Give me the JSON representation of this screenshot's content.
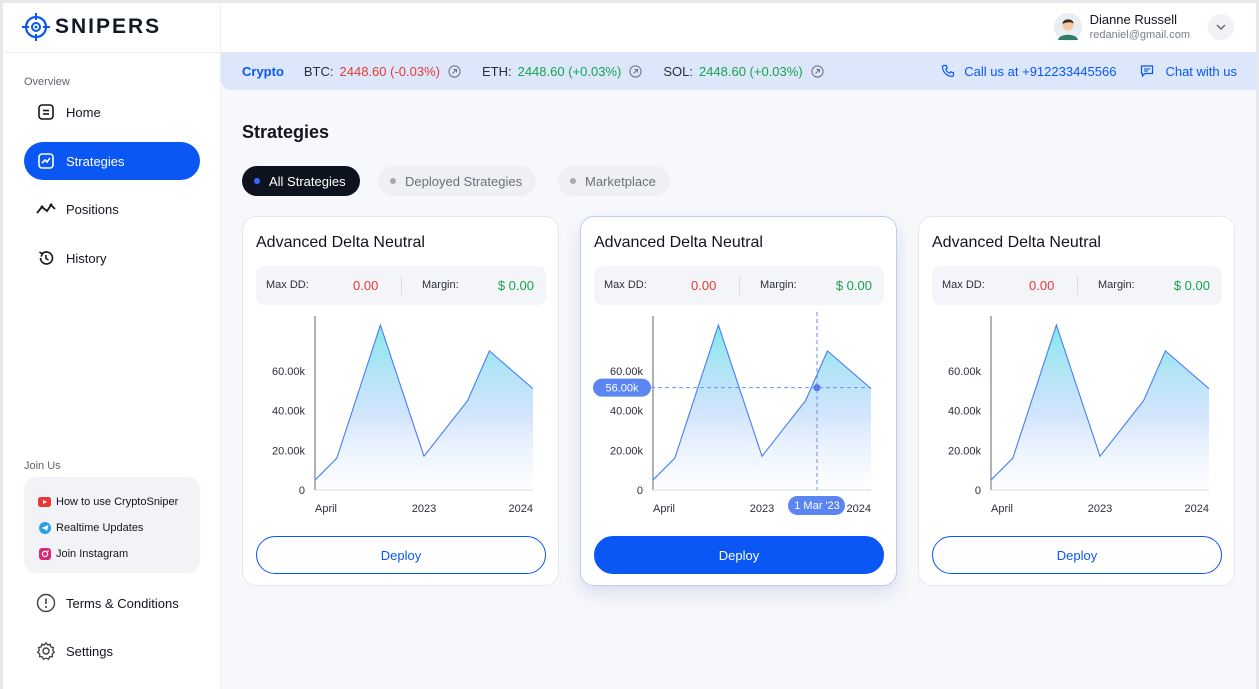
{
  "brand": {
    "name": "SNIPERS",
    "accent": "#0a57f5"
  },
  "sidebar": {
    "overview_label": "Overview",
    "items": [
      {
        "label": "Home",
        "icon": "home-icon"
      },
      {
        "label": "Strategies",
        "icon": "chart-icon",
        "active": true
      },
      {
        "label": "Positions",
        "icon": "trend-icon"
      },
      {
        "label": "History",
        "icon": "history-icon"
      }
    ],
    "join_label": "Join Us",
    "join_links": [
      {
        "label": "How to use CryptoSniper",
        "icon": "youtube-icon"
      },
      {
        "label": "Realtime Updates",
        "icon": "telegram-icon"
      },
      {
        "label": "Join Instagram",
        "icon": "instagram-icon"
      }
    ],
    "bottom_items": [
      {
        "label": "Terms & Conditions",
        "icon": "info-icon"
      },
      {
        "label": "Settings",
        "icon": "gear-icon"
      }
    ]
  },
  "user": {
    "name": "Dianne Russell",
    "email": "redaniel@gmail.com"
  },
  "ticker": {
    "label": "Crypto",
    "coins": [
      {
        "symbol": "BTC:",
        "value": "2448.60 (-0.03%)",
        "trend": "down"
      },
      {
        "symbol": "ETH:",
        "value": "2448.60 (+0.03%)",
        "trend": "up"
      },
      {
        "symbol": "SOL:",
        "value": "2448.60 (+0.03%)",
        "trend": "up"
      }
    ],
    "call_label": "Call us at +912233445566",
    "chat_label": "Chat with us"
  },
  "page": {
    "title": "Strategies"
  },
  "filters": [
    {
      "label": "All Strategies",
      "active": true
    },
    {
      "label": "Deployed Strategies",
      "active": false
    },
    {
      "label": "Marketplace",
      "active": false
    }
  ],
  "cards": [
    {
      "title": "Advanced Delta Neutral",
      "max_dd_label": "Max DD:",
      "max_dd": "0.00",
      "margin_label": "Margin:",
      "margin": "$ 0.00",
      "deploy_label": "Deploy"
    },
    {
      "title": "Advanced Delta Neutral",
      "max_dd_label": "Max DD:",
      "max_dd": "0.00",
      "margin_label": "Margin:",
      "margin": "$ 0.00",
      "deploy_label": "Deploy",
      "tooltip_value": "56.00k",
      "tooltip_date": "1 Mar '23"
    },
    {
      "title": "Advanced Delta Neutral",
      "max_dd_label": "Max DD:",
      "max_dd": "0.00",
      "margin_label": "Margin:",
      "margin": "$ 0.00",
      "deploy_label": "Deploy"
    }
  ],
  "chart_data": {
    "type": "area",
    "y_ticks": [
      "0",
      "20.00k",
      "40.00k",
      "60.00k"
    ],
    "x_ticks": [
      "April",
      "2023",
      "2024"
    ],
    "ylim": [
      0,
      80000
    ],
    "points": [
      {
        "x": 0.0,
        "y": 5000
      },
      {
        "x": 0.1,
        "y": 16000
      },
      {
        "x": 0.3,
        "y": 83000
      },
      {
        "x": 0.5,
        "y": 17000
      },
      {
        "x": 0.7,
        "y": 45000
      },
      {
        "x": 0.8,
        "y": 70000
      },
      {
        "x": 1.0,
        "y": 51000
      }
    ],
    "grid": false
  }
}
